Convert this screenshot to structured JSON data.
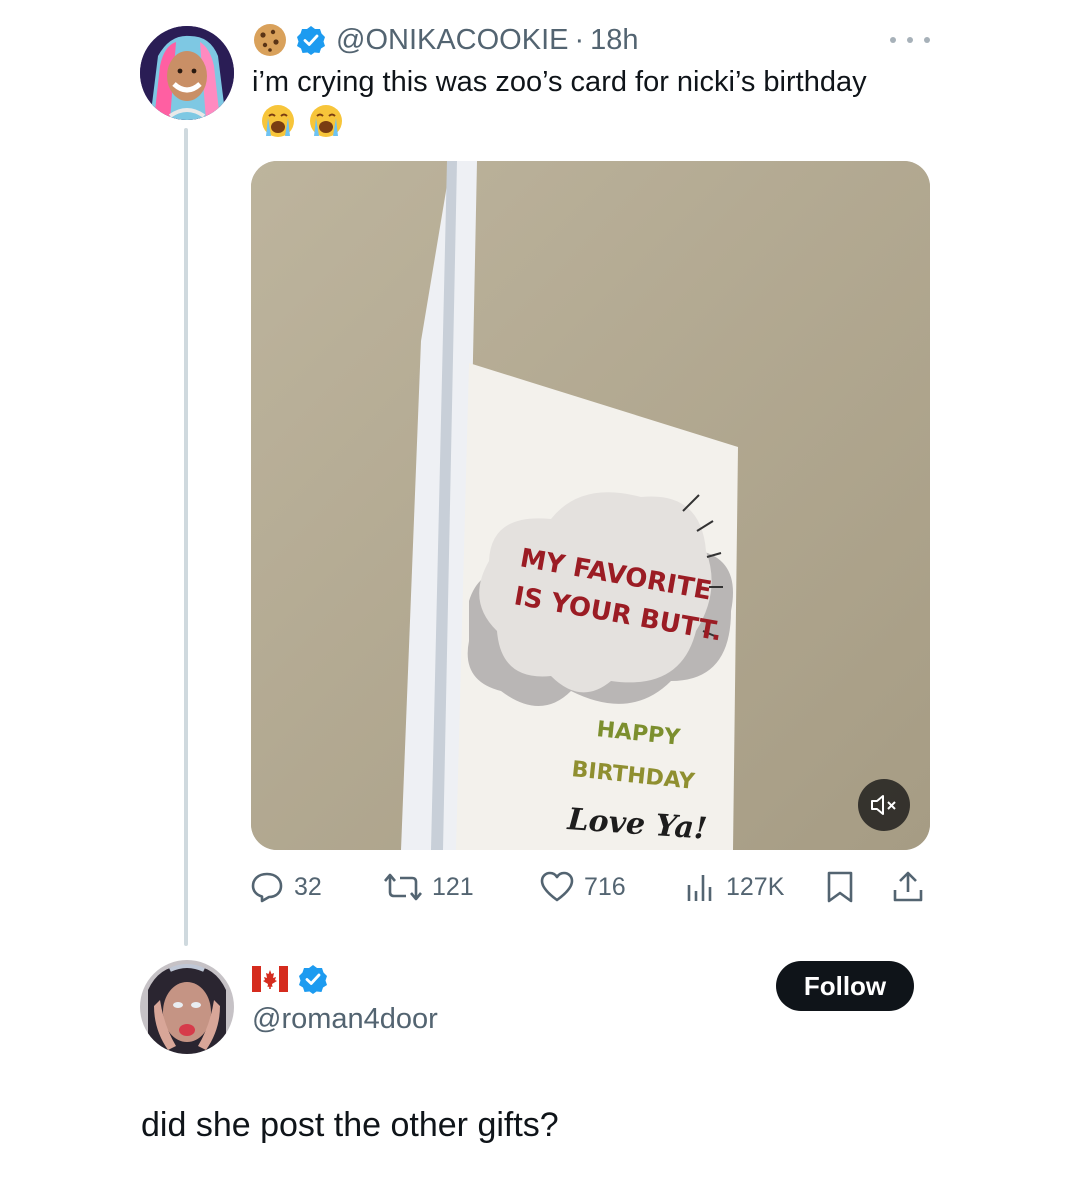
{
  "tweet": {
    "handle": "@ONIKACOOKIE",
    "separator": "·",
    "time": "18h",
    "badge_icon": "cookie-icon",
    "verified_icon": "verified-badge-icon",
    "more_icon": "more-options-icon",
    "text": "i’m crying this was zoo’s card for nicki’s birthday",
    "text_emojis": [
      "loudly-crying-face-icon",
      "loudly-crying-face-icon"
    ],
    "media": {
      "card_text_line1": "MY FAVORITE",
      "card_text_line2": "IS YOUR BUTT.",
      "card_happy": "HAPPY",
      "card_birthday": "BIRTHDAY",
      "card_love": "Love Ya!",
      "mute_icon": "speaker-muted-icon"
    },
    "actions": {
      "replies": "32",
      "reposts": "121",
      "likes": "716",
      "views": "127K"
    }
  },
  "reply": {
    "flag_icon": "canada-flag-icon",
    "verified_icon": "verified-badge-icon",
    "handle": "@roman4door",
    "follow_label": "Follow",
    "text": "did she post the other gifts?"
  },
  "colors": {
    "text_primary": "#0f1419",
    "text_secondary": "#536471",
    "verified_blue": "#1d9bf0",
    "thread_line": "#cfd9de",
    "follow_bg": "#0f1419",
    "card_red": "#9b1c24"
  }
}
